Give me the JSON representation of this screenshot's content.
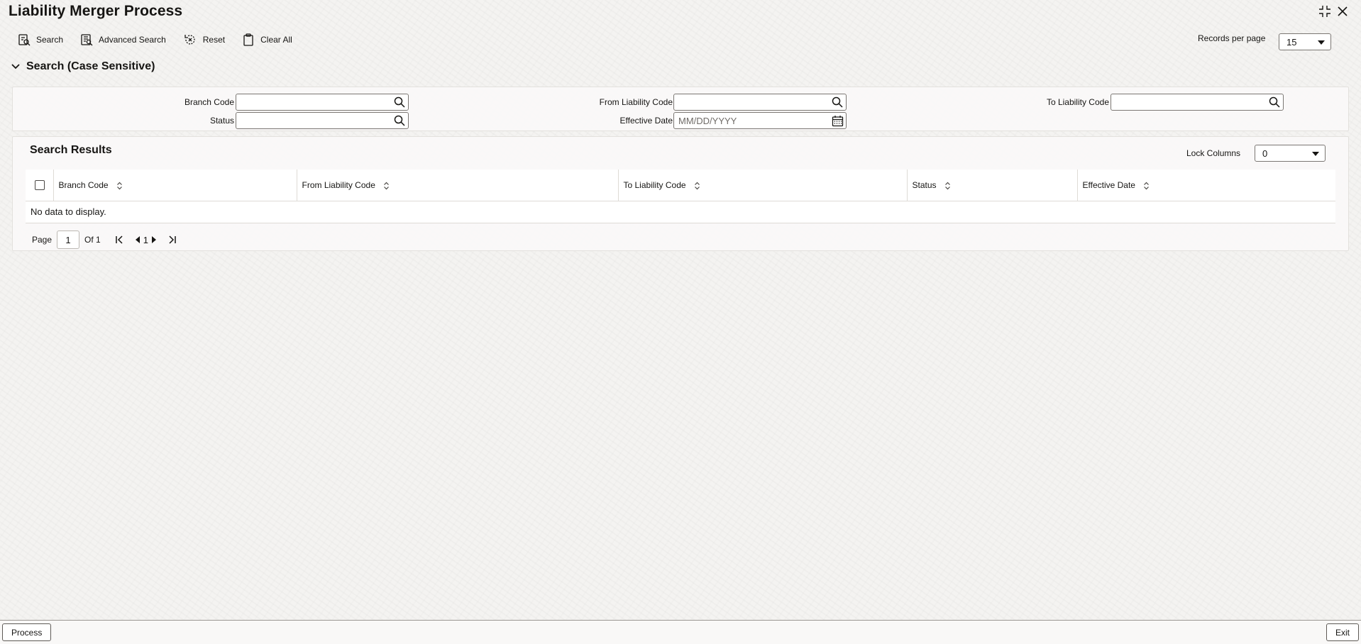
{
  "window": {
    "title": "Liability Merger Process"
  },
  "toolbar": {
    "search_label": "Search",
    "advanced_search_label": "Advanced Search",
    "reset_label": "Reset",
    "clear_all_label": "Clear All",
    "records_per_page_label": "Records per page",
    "records_per_page_value": "15"
  },
  "search_section": {
    "title": "Search (Case Sensitive)",
    "branch_code_label": "Branch Code",
    "status_label": "Status",
    "from_liability_code_label": "From Liability Code",
    "effective_date_label": "Effective Date",
    "effective_date_placeholder": "MM/DD/YYYY",
    "to_liability_code_label": "To Liability Code"
  },
  "results": {
    "title": "Search Results",
    "lock_columns_label": "Lock Columns",
    "lock_columns_value": "0",
    "columns": [
      "Branch Code",
      "From Liability Code",
      "To Liability Code",
      "Status",
      "Effective Date"
    ],
    "empty_message": "No data to display."
  },
  "pagination": {
    "page_label": "Page",
    "current_page": "1",
    "of_label": "Of 1",
    "page_number": "1"
  },
  "footer": {
    "process_label": "Process",
    "exit_label": "Exit"
  }
}
